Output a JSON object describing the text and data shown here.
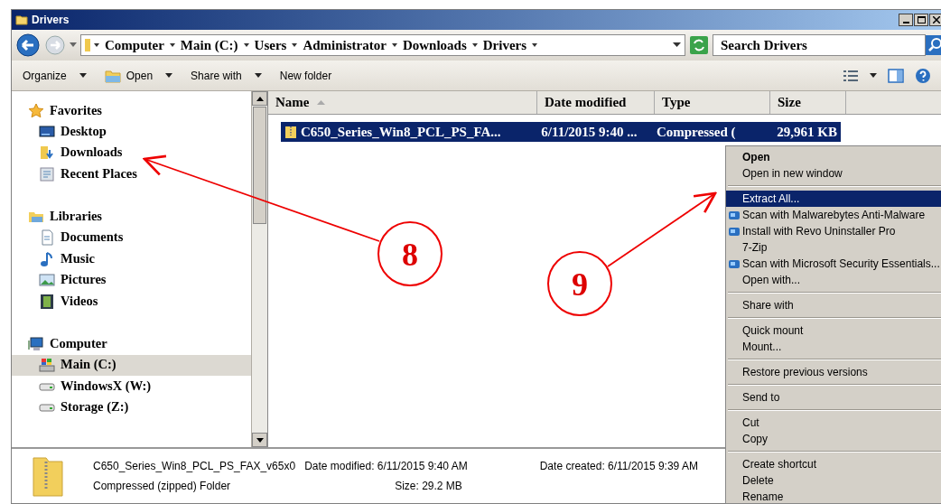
{
  "window": {
    "title": "Drivers"
  },
  "address_bar": {
    "crumbs": [
      "Computer",
      "Main (C:)",
      "Users",
      "Administrator",
      "Downloads",
      "Drivers"
    ]
  },
  "search": {
    "placeholder": "Search Drivers"
  },
  "toolbar": [
    {
      "label": "Organize",
      "dropdown": true,
      "icon": false
    },
    {
      "label": "Open",
      "dropdown": true,
      "icon": true
    },
    {
      "label": "Share with",
      "dropdown": true,
      "icon": false
    },
    {
      "label": "New folder",
      "dropdown": false,
      "icon": false
    }
  ],
  "nav": [
    {
      "label": "Favorites",
      "kind": "favorites",
      "selected": false,
      "children": [
        {
          "label": "Desktop",
          "kind": "desktop",
          "selected": false
        },
        {
          "label": "Downloads",
          "kind": "downloads",
          "selected": false
        },
        {
          "label": "Recent Places",
          "kind": "recent",
          "selected": false
        }
      ]
    },
    {
      "label": "Libraries",
      "kind": "libraries",
      "selected": false,
      "children": [
        {
          "label": "Documents",
          "kind": "documents",
          "selected": false
        },
        {
          "label": "Music",
          "kind": "music",
          "selected": false
        },
        {
          "label": "Pictures",
          "kind": "pictures",
          "selected": false
        },
        {
          "label": "Videos",
          "kind": "videos",
          "selected": false
        }
      ]
    },
    {
      "label": "Computer",
      "kind": "computer",
      "selected": false,
      "children": [
        {
          "label": "Main (C:)",
          "kind": "system-drive",
          "selected": true
        },
        {
          "label": "WindowsX (W:)",
          "kind": "drive",
          "selected": false
        },
        {
          "label": "Storage (Z:)",
          "kind": "drive",
          "selected": false
        }
      ]
    }
  ],
  "table": {
    "columns": [
      "Name",
      "Date modified",
      "Type",
      "Size"
    ],
    "rows": [
      {
        "cells": [
          "C650_Series_Win8_PCL_PS_FA...",
          "6/11/2015 9:40 ...",
          "Compressed (",
          "29,961 KB"
        ],
        "selected": true
      }
    ]
  },
  "context_menu": [
    {
      "kind": "item",
      "label": "Open",
      "default": true,
      "selected": false,
      "icon": false
    },
    {
      "kind": "item",
      "label": "Open in new window",
      "default": false,
      "selected": false,
      "icon": false
    },
    {
      "kind": "separator"
    },
    {
      "kind": "item",
      "label": "Extract All...",
      "default": false,
      "selected": true,
      "icon": false
    },
    {
      "kind": "item",
      "label": "Scan with Malwarebytes Anti-Malware",
      "default": false,
      "selected": false,
      "icon": true
    },
    {
      "kind": "item",
      "label": "Install with Revo Uninstaller Pro",
      "default": false,
      "selected": false,
      "icon": true
    },
    {
      "kind": "item",
      "label": "7-Zip",
      "default": false,
      "selected": false,
      "icon": false
    },
    {
      "kind": "item",
      "label": "Scan with Microsoft Security Essentials...",
      "default": false,
      "selected": false,
      "icon": true
    },
    {
      "kind": "item",
      "label": "Open with...",
      "default": false,
      "selected": false,
      "icon": false
    },
    {
      "kind": "separator"
    },
    {
      "kind": "item",
      "label": "Share with",
      "default": false,
      "selected": false,
      "icon": false
    },
    {
      "kind": "separator"
    },
    {
      "kind": "item",
      "label": "Quick mount",
      "default": false,
      "selected": false,
      "icon": false
    },
    {
      "kind": "item",
      "label": "Mount...",
      "default": false,
      "selected": false,
      "icon": false
    },
    {
      "kind": "separator"
    },
    {
      "kind": "item",
      "label": "Restore previous versions",
      "default": false,
      "selected": false,
      "icon": false
    },
    {
      "kind": "separator"
    },
    {
      "kind": "item",
      "label": "Send to",
      "default": false,
      "selected": false,
      "icon": false
    },
    {
      "kind": "separator"
    },
    {
      "kind": "item",
      "label": "Cut",
      "default": false,
      "selected": false,
      "icon": false
    },
    {
      "kind": "item",
      "label": "Copy",
      "default": false,
      "selected": false,
      "icon": false
    },
    {
      "kind": "separator"
    },
    {
      "kind": "item",
      "label": "Create shortcut",
      "default": false,
      "selected": false,
      "icon": false
    },
    {
      "kind": "item",
      "label": "Delete",
      "default": false,
      "selected": false,
      "icon": false
    },
    {
      "kind": "item",
      "label": "Rename",
      "default": false,
      "selected": false,
      "icon": false
    }
  ],
  "details": {
    "name": "C650_Series_Win8_PCL_PS_FAX_v65x0",
    "type": "Compressed (zipped) Folder",
    "modified_label": "Date modified:",
    "modified": "6/11/2015 9:40 AM",
    "size_label": "Size:",
    "size": "29.2 MB",
    "created_label": "Date created:",
    "created": "6/11/2015 9:39 AM"
  },
  "callouts": [
    {
      "number": "8"
    },
    {
      "number": "9"
    }
  ]
}
